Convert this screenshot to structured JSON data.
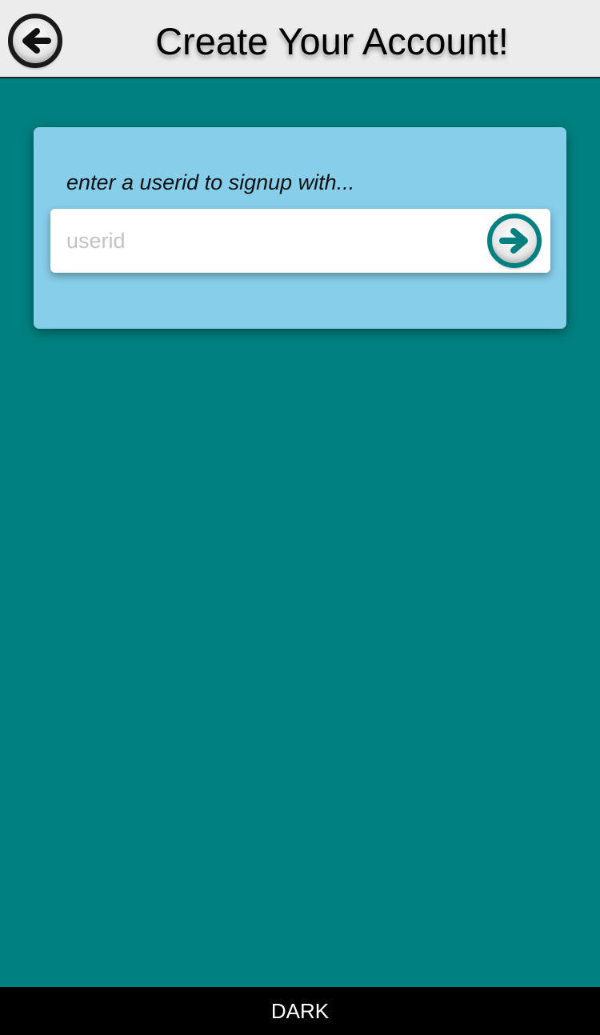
{
  "header": {
    "title": "Create Your Account!",
    "back_icon": "back-arrow-circle-icon"
  },
  "signup": {
    "prompt": "enter a userid to signup with...",
    "userid_value": "",
    "userid_placeholder": "userid",
    "submit_icon": "forward-arrow-circle-icon"
  },
  "footer": {
    "theme_toggle_label": "DARK"
  },
  "colors": {
    "background": "#008080",
    "card": "#87CEEB",
    "header": "#ECECEC",
    "footer": "#000000",
    "accent": "#008080"
  }
}
